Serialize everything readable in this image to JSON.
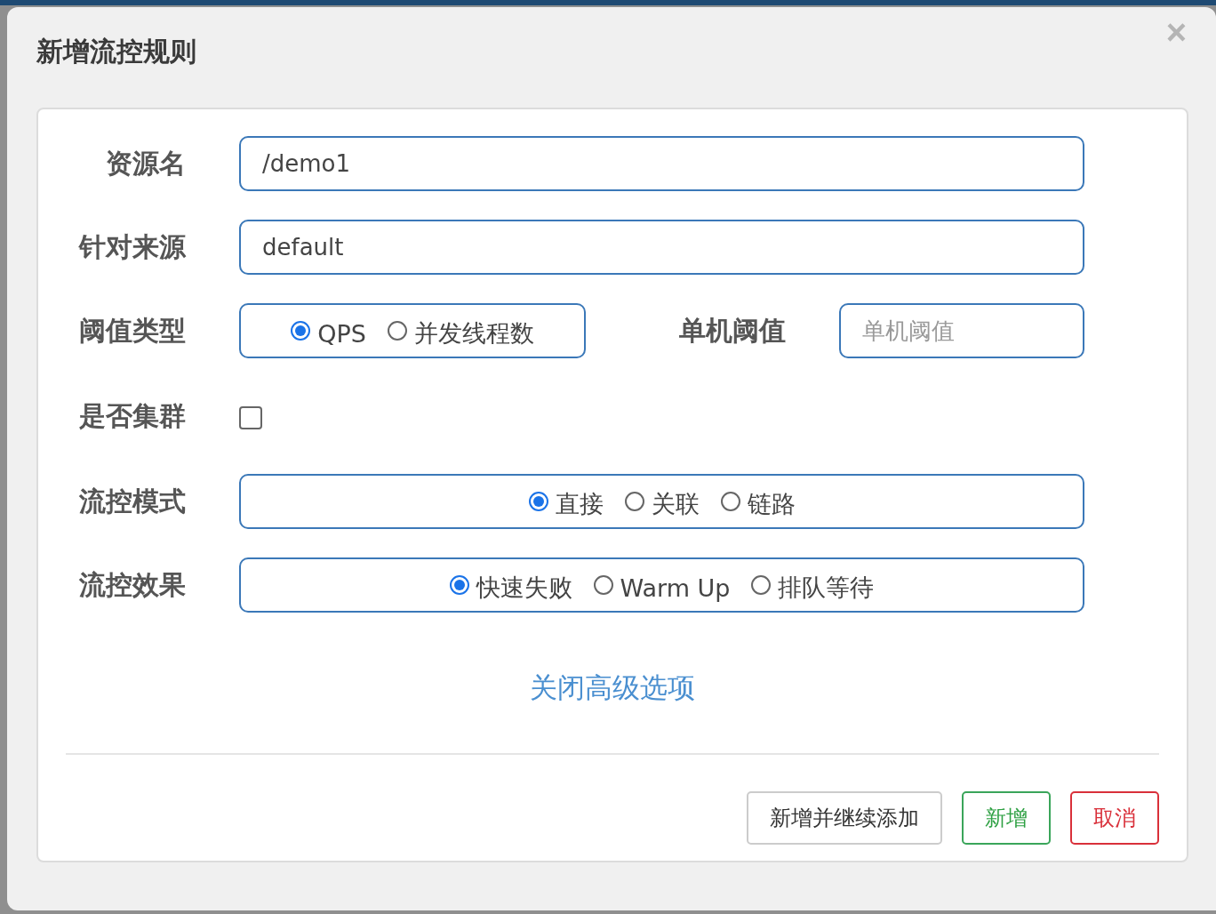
{
  "dialog": {
    "title": "新增流控规则",
    "close": "×"
  },
  "fields": [
    {
      "kind": "text",
      "label": "资源名",
      "value": "/demo1"
    },
    {
      "kind": "text",
      "label": "针对来源",
      "value": "default"
    },
    {
      "kind": "radio_with_input",
      "label": "阈值类型",
      "options": [
        {
          "label": "QPS",
          "selected": true
        },
        {
          "label": "并发线程数",
          "selected": false
        }
      ],
      "side_label": "单机阈值",
      "side_placeholder": "单机阈值"
    },
    {
      "kind": "checkbox",
      "label": "是否集群",
      "checked": false
    },
    {
      "kind": "radio",
      "label": "流控模式",
      "options": [
        {
          "label": "直接",
          "selected": true
        },
        {
          "label": "关联",
          "selected": false
        },
        {
          "label": "链路",
          "selected": false
        }
      ]
    },
    {
      "kind": "radio",
      "label": "流控效果",
      "options": [
        {
          "label": "快速失败",
          "selected": true
        },
        {
          "label": "Warm Up",
          "selected": false
        },
        {
          "label": "排队等待",
          "selected": false
        }
      ]
    }
  ],
  "advanced_link": "关闭高级选项",
  "buttons": [
    {
      "label": "新增并继续添加",
      "kind": "default"
    },
    {
      "label": "新增",
      "kind": "success"
    },
    {
      "label": "取消",
      "kind": "danger"
    }
  ]
}
